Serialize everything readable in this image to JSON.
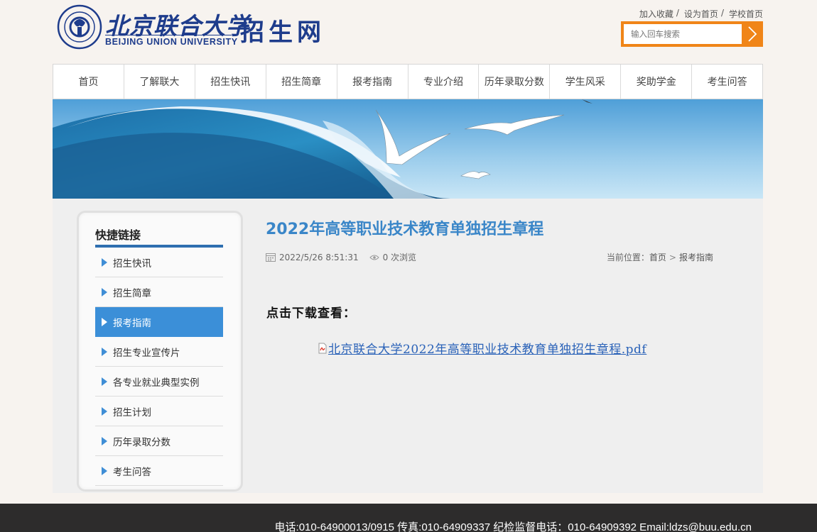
{
  "header": {
    "logo_cn": "北京联合大学",
    "logo_en": "BEIJING UNION UNIVERSITY",
    "site_title": "招生网",
    "links": [
      {
        "label": "加入收藏"
      },
      {
        "label": "设为首页"
      },
      {
        "label": "学校首页"
      }
    ],
    "search_placeholder": "输入回车搜索",
    "accent_color": "#f08518"
  },
  "nav": {
    "items": [
      "首页",
      "了解联大",
      "招生快讯",
      "招生简章",
      "报考指南",
      "专业介绍",
      "历年录取分数",
      "学生风采",
      "奖助学金",
      "考生问答"
    ]
  },
  "sidebar": {
    "title": "快捷链接",
    "items": [
      "招生快讯",
      "招生简章",
      "报考指南",
      "招生专业宣传片",
      "各专业就业典型实例",
      "招生计划",
      "历年录取分数",
      "考生问答"
    ],
    "active_index": 2,
    "active_color": "#3b8fd8"
  },
  "article": {
    "title": "2022年高等职业技术教育单独招生章程",
    "date": "2022/5/26 8:51:31",
    "views": "0 次浏览",
    "breadcrumb_prefix": "当前位置：",
    "breadcrumb": [
      "首页",
      "报考指南"
    ],
    "lead": "点击下载查看：",
    "attachment": "北京联合大学2022年高等职业技术教育单独招生章程.pdf",
    "icons": [
      "calendar-icon",
      "eye-icon",
      "pdf-icon"
    ]
  },
  "footer": {
    "text": "电话:010-64900013/0915    传真:010-64909337    纪检监督电话：010-64909392    Email:ldzs@buu.edu.cn"
  }
}
